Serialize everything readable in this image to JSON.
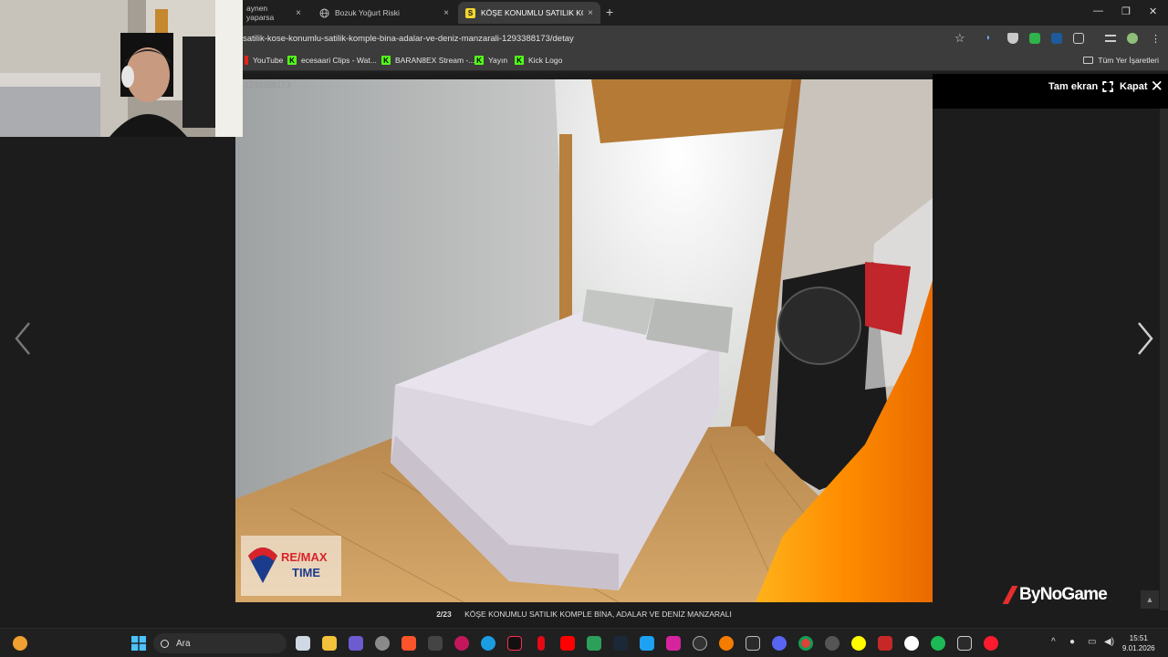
{
  "browser": {
    "tabs": [
      {
        "label": "aynen yaparsa",
        "close": "×"
      },
      {
        "label": "Bozuk Yoğurt Riski",
        "close": "×"
      },
      {
        "label": "KÖŞE KONUMLU SATILIK KOMP",
        "favicon_text": "S",
        "close": "×"
      }
    ],
    "new_tab": "+",
    "window_controls": {
      "minimize": "—",
      "restore": "❐",
      "close": "✕"
    },
    "url": "satilik-kose-konumlu-satilik-komple-bina-adalar-ve-deniz-manzarali-1293388173/detay",
    "bookmarks": [
      {
        "label": "YouTube",
        "type": "youtube"
      },
      {
        "label": "ecesaari Clips - Wat...",
        "type": "kick"
      },
      {
        "label": "BARAN8EX Stream -...",
        "type": "kick"
      },
      {
        "label": "Yayın",
        "type": "kick"
      },
      {
        "label": "Kick Logo",
        "type": "kick"
      }
    ],
    "all_bookmarks": "Tüm Yer İşaretleri"
  },
  "viewer": {
    "listing_id": "1293388173",
    "fullscreen_label": "Tam ekran",
    "close_label": "Kapat",
    "counter": "2/23",
    "caption": "KÖŞE KONUMLU SATILIK KOMPLE BİNA, ADALAR VE DENİZ MANZARALI",
    "watermark_brand": "RE/MAX",
    "watermark_sub": "TIME",
    "overlay_logo": "ByNoGame"
  },
  "taskbar": {
    "search_placeholder": "Ara",
    "time": "15:51",
    "date": "9.01.2026"
  },
  "colors": {
    "chrome_bg": "#1f1f1f",
    "toolbar_bg": "#3c3c3c",
    "kick_green": "#53fc18",
    "bynogame_red": "#e62d2d",
    "remax_red": "#d8232a",
    "remax_blue": "#1b3c8c"
  }
}
